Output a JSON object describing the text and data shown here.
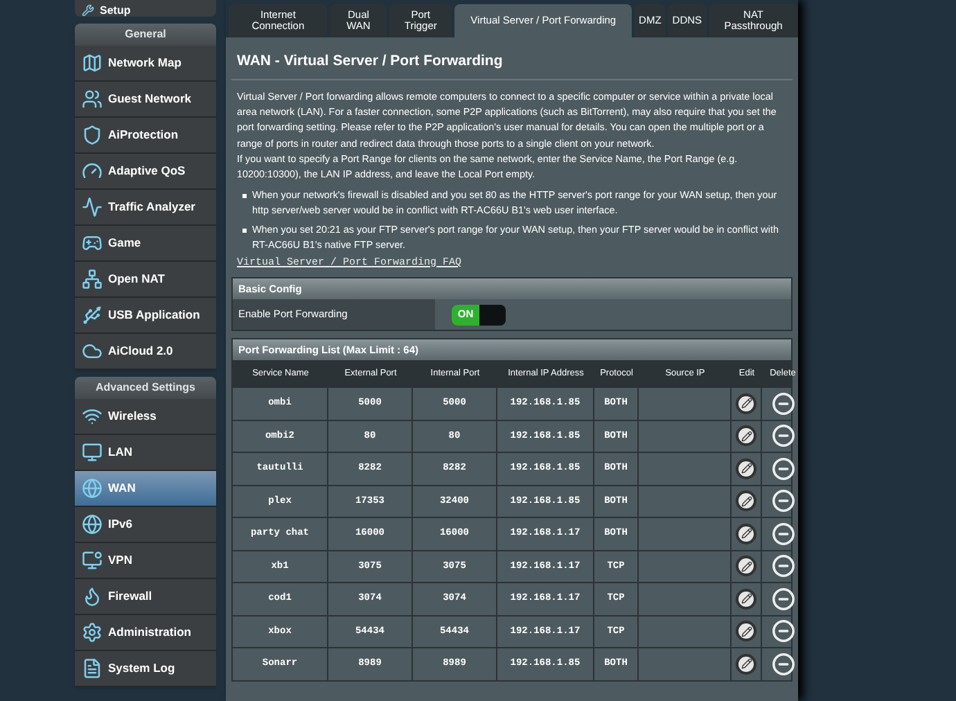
{
  "sidebar": {
    "top_item": {
      "label": "Setup"
    },
    "sections": [
      {
        "title": "General",
        "items": [
          {
            "label": "Network Map",
            "selected": false
          },
          {
            "label": "Guest Network",
            "selected": false
          },
          {
            "label": "AiProtection",
            "selected": false
          },
          {
            "label": "Adaptive QoS",
            "selected": false
          },
          {
            "label": "Traffic Analyzer",
            "selected": false
          },
          {
            "label": "Game",
            "selected": false
          },
          {
            "label": "Open NAT",
            "selected": false
          },
          {
            "label": "USB Application",
            "selected": false
          },
          {
            "label": "AiCloud 2.0",
            "selected": false
          }
        ]
      },
      {
        "title": "Advanced Settings",
        "items": [
          {
            "label": "Wireless",
            "selected": false
          },
          {
            "label": "LAN",
            "selected": false
          },
          {
            "label": "WAN",
            "selected": true
          },
          {
            "label": "IPv6",
            "selected": false
          },
          {
            "label": "VPN",
            "selected": false
          },
          {
            "label": "Firewall",
            "selected": false
          },
          {
            "label": "Administration",
            "selected": false
          },
          {
            "label": "System Log",
            "selected": false
          }
        ]
      }
    ]
  },
  "tabs": [
    {
      "label": "Internet Connection",
      "selected": false
    },
    {
      "label": "Dual WAN",
      "selected": false
    },
    {
      "label": "Port Trigger",
      "selected": false
    },
    {
      "label": "Virtual Server / Port Forwarding",
      "selected": true
    },
    {
      "label": "DMZ",
      "selected": false
    },
    {
      "label": "DDNS",
      "selected": false
    },
    {
      "label": "NAT Passthrough",
      "selected": false
    }
  ],
  "page_title": "WAN - Virtual Server / Port Forwarding",
  "intro": [
    "Virtual Server / Port forwarding allows remote computers to connect to a specific computer or service within a private local area network (LAN). For a faster connection, some P2P applications (such as BitTorrent), may also require that you set the port forwarding setting. Please refer to the P2P application's user manual for details. You can open the multiple port or a range of ports in router and redirect data through those ports to a single client on your network.",
    "If you want to specify a Port Range for clients on the same network, enter the Service Name, the Port Range (e.g. 10200:10300), the LAN IP address, and leave the Local Port empty."
  ],
  "notes": [
    "When your network's firewall is disabled and you set 80 as the HTTP server's port range for your WAN setup, then your http server/web server would be in conflict with RT-AC66U B1's web user interface.",
    "When you set 20:21 as your FTP server's port range for your WAN setup, then your FTP server would be in conflict with RT-AC66U B1's native FTP server."
  ],
  "faq_link": "Virtual Server / Port Forwarding FAQ",
  "basic_config": {
    "title": "Basic Config",
    "label": "Enable Port Forwarding",
    "toggle": {
      "on": true,
      "label": "ON"
    }
  },
  "table": {
    "title": "Port Forwarding List (Max Limit : 64)",
    "columns": [
      "Service Name",
      "External Port",
      "Internal Port",
      "Internal IP Address",
      "Protocol",
      "Source IP",
      "Edit",
      "Delete"
    ],
    "rows": [
      [
        "ombi",
        "5000",
        "5000",
        "192.168.1.85",
        "BOTH"
      ],
      [
        "ombi2",
        "80",
        "80",
        "192.168.1.85",
        "BOTH"
      ],
      [
        "tautulli",
        "8282",
        "8282",
        "192.168.1.85",
        "BOTH"
      ],
      [
        "plex",
        "17353",
        "32400",
        "192.168.1.85",
        "BOTH"
      ],
      [
        "party chat",
        "16000",
        "16000",
        "192.168.1.17",
        "BOTH"
      ],
      [
        "xb1",
        "3075",
        "3075",
        "192.168.1.17",
        "TCP"
      ],
      [
        "cod1",
        "3074",
        "3074",
        "192.168.1.17",
        "TCP"
      ],
      [
        "xbox",
        "54434",
        "54434",
        "192.168.1.17",
        "TCP"
      ],
      [
        "Sonarr",
        "8989",
        "8989",
        "192.168.1.85",
        "BOTH"
      ]
    ]
  }
}
